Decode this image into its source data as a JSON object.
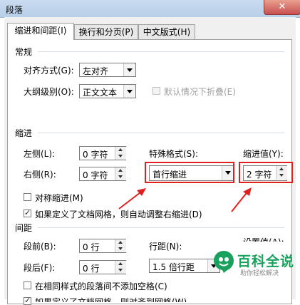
{
  "window": {
    "title": "段落",
    "close_glyph": "✕"
  },
  "tabs": [
    {
      "label": "缩进和间距(I)"
    },
    {
      "label": "换行和分页(P)"
    },
    {
      "label": "中文版式(H)"
    }
  ],
  "general": {
    "heading": "常规",
    "alignment": {
      "label": "对齐方式(G):",
      "value": "左对齐"
    },
    "outline": {
      "label": "大纲级别(O):",
      "value": "正文文本"
    },
    "collapse": {
      "label": "默认情况下折叠(E)"
    }
  },
  "indent": {
    "heading": "缩进",
    "left": {
      "label": "左侧(L):",
      "value": "0 字符"
    },
    "right": {
      "label": "右侧(R):",
      "value": "0 字符"
    },
    "special": {
      "label": "特殊格式(S):",
      "value": "首行缩进"
    },
    "by": {
      "label": "缩进值(Y):",
      "value": "2 字符"
    },
    "mirror": {
      "label": "对称缩进(M)"
    },
    "auto_adjust": {
      "label": "如果定义了文档网格，则自动调整右缩进(D)"
    }
  },
  "spacing": {
    "heading": "间距",
    "before": {
      "label": "段前(B):",
      "value": "0 行"
    },
    "after": {
      "label": "段后(F):",
      "value": "0 行"
    },
    "line": {
      "label": "行距(N):",
      "value": "1.5 倍行距"
    },
    "at": {
      "label": "设置值(A):"
    },
    "no_space": {
      "label": "在相同样式的段落间不添加空格(C)"
    },
    "snap": {
      "label": "如果定义了文档网格，则对齐到网格(W)"
    }
  },
  "watermark": {
    "brand": "百科全说",
    "slogan": "助你轻松解决"
  },
  "colors": {
    "annotation": "#e02020",
    "brand": "#1aa15d"
  }
}
